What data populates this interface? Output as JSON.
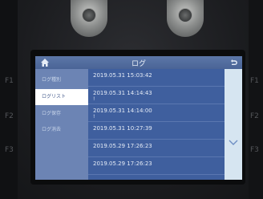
{
  "window": {
    "title": "ログ"
  },
  "device": {
    "f1": "F1",
    "f2": "F2",
    "f3": "F3"
  },
  "sidebar": {
    "items": [
      {
        "label": "ログ種別"
      },
      {
        "label": "ログリスト"
      },
      {
        "label": "ログ保存"
      },
      {
        "label": "ログ消去"
      }
    ],
    "active_index": 1
  },
  "log": {
    "rows": [
      {
        "time": "2019.05.31 15:03:42",
        "extra": ""
      },
      {
        "time": "2019.05.31 14:14:43",
        "extra": "!"
      },
      {
        "time": "2019.05.31 14:14:00",
        "extra": "!"
      },
      {
        "time": "2019.05.31 10:27:39",
        "extra": ""
      },
      {
        "time": "2019.05.29 17:26:23",
        "extra": ""
      },
      {
        "time": "2019.05.29 17:26:23",
        "extra": ""
      }
    ]
  },
  "icons": {
    "home": "home-icon",
    "back": "back-arrow-icon",
    "scroll_down": "chevron-down-icon"
  },
  "colors": {
    "title_bar": "#4a6496",
    "list_bg": "#3f5f9e",
    "sidebar_bg": "#6c84b4"
  }
}
